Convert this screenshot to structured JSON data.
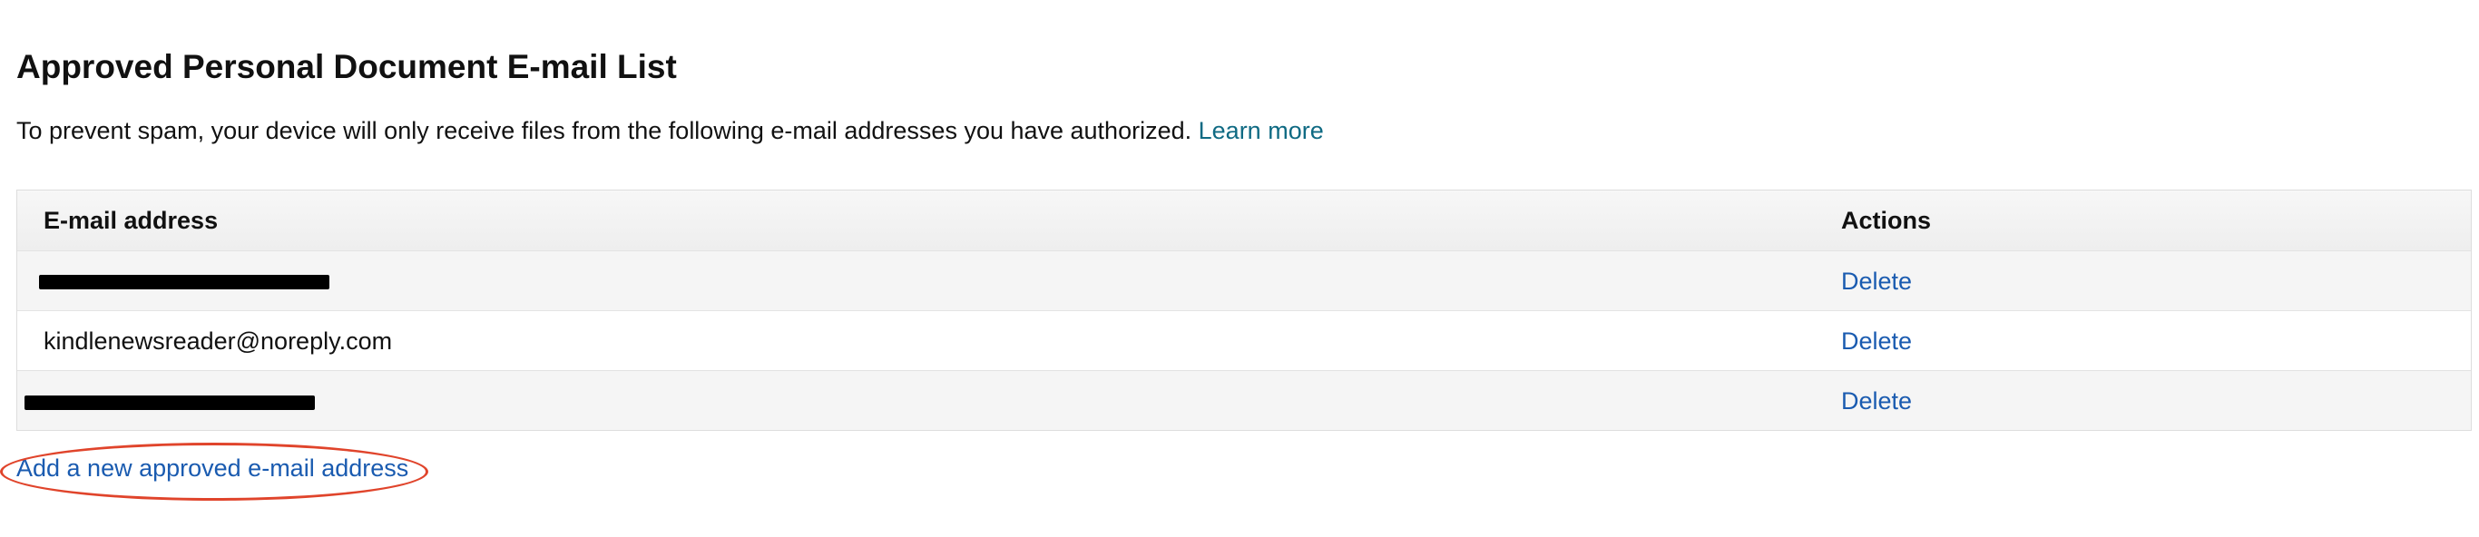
{
  "page": {
    "title": "Approved Personal Document E-mail List",
    "description": "To prevent spam, your device will only receive files from the following e-mail addresses you have authorized.",
    "learn_more": "Learn more"
  },
  "table": {
    "headers": {
      "email": "E-mail address",
      "actions": "Actions"
    },
    "rows": [
      {
        "email": "",
        "action": "Delete"
      },
      {
        "email": "kindlenewsreader@noreply.com",
        "action": "Delete"
      },
      {
        "email": "",
        "action": "Delete"
      }
    ]
  },
  "add_link": "Add a new approved e-mail address",
  "colors": {
    "link": "#1a5bb0",
    "learn_more": "#0f6a83",
    "annotation": "#e0442b"
  }
}
